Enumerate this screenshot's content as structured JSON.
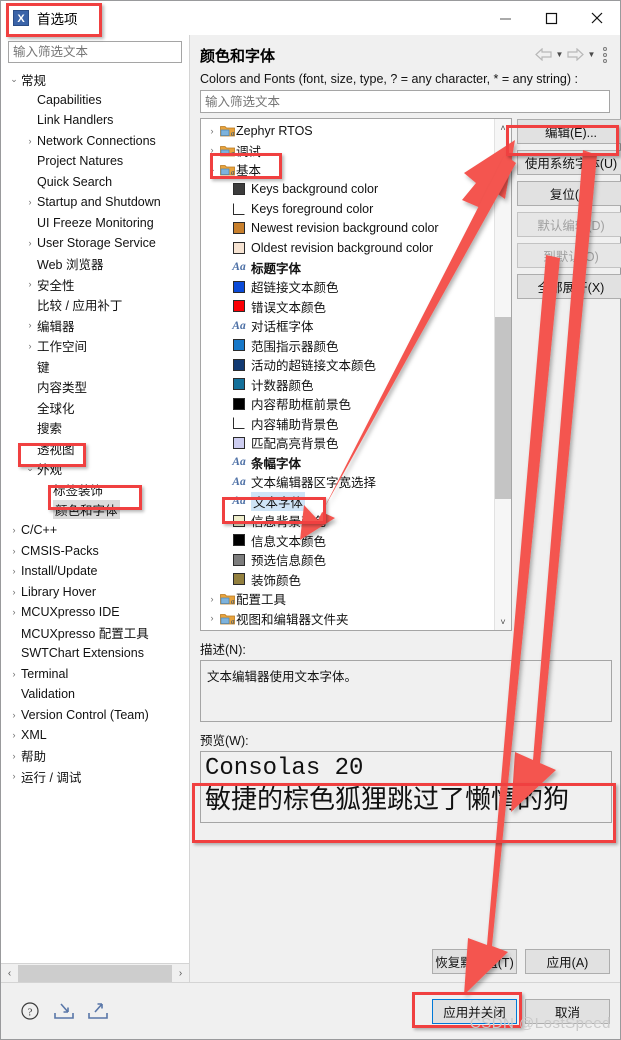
{
  "window": {
    "title": "首选项",
    "app_icon": "x-icon",
    "minimize_label": "—",
    "maximize_label": "□",
    "close_label": "✕"
  },
  "left": {
    "filter_placeholder": "输入筛选文本",
    "tree": [
      {
        "label": "常规",
        "level": 0,
        "arrow": "down"
      },
      {
        "label": "Capabilities",
        "level": 1,
        "arrow": "none"
      },
      {
        "label": "Link Handlers",
        "level": 1,
        "arrow": "none"
      },
      {
        "label": "Network Connections",
        "level": 1,
        "arrow": "right"
      },
      {
        "label": "Project Natures",
        "level": 1,
        "arrow": "none"
      },
      {
        "label": "Quick Search",
        "level": 1,
        "arrow": "none"
      },
      {
        "label": "Startup and Shutdown",
        "level": 1,
        "arrow": "right"
      },
      {
        "label": "UI Freeze Monitoring",
        "level": 1,
        "arrow": "none"
      },
      {
        "label": "User Storage Service",
        "level": 1,
        "arrow": "right"
      },
      {
        "label": "Web 浏览器",
        "level": 1,
        "arrow": "none"
      },
      {
        "label": "安全性",
        "level": 1,
        "arrow": "right"
      },
      {
        "label": "比较 / 应用补丁",
        "level": 1,
        "arrow": "none"
      },
      {
        "label": "编辑器",
        "level": 1,
        "arrow": "right"
      },
      {
        "label": "工作空间",
        "level": 1,
        "arrow": "right"
      },
      {
        "label": "键",
        "level": 1,
        "arrow": "none"
      },
      {
        "label": "内容类型",
        "level": 1,
        "arrow": "none"
      },
      {
        "label": "全球化",
        "level": 1,
        "arrow": "none"
      },
      {
        "label": "搜索",
        "level": 1,
        "arrow": "none"
      },
      {
        "label": "透视图",
        "level": 1,
        "arrow": "none"
      },
      {
        "label": "外观",
        "level": 1,
        "arrow": "down"
      },
      {
        "label": "标签装饰",
        "level": 2,
        "arrow": "none"
      },
      {
        "label": "颜色和字体",
        "level": 2,
        "arrow": "none",
        "selected": true
      },
      {
        "label": "C/C++",
        "level": 0,
        "arrow": "right"
      },
      {
        "label": "CMSIS-Packs",
        "level": 0,
        "arrow": "right"
      },
      {
        "label": "Install/Update",
        "level": 0,
        "arrow": "right"
      },
      {
        "label": "Library Hover",
        "level": 0,
        "arrow": "right"
      },
      {
        "label": "MCUXpresso IDE",
        "level": 0,
        "arrow": "right"
      },
      {
        "label": "MCUXpresso 配置工具",
        "level": 0,
        "arrow": "none"
      },
      {
        "label": "SWTChart Extensions",
        "level": 0,
        "arrow": "none"
      },
      {
        "label": "Terminal",
        "level": 0,
        "arrow": "right"
      },
      {
        "label": "Validation",
        "level": 0,
        "arrow": "none"
      },
      {
        "label": "Version Control (Team)",
        "level": 0,
        "arrow": "right"
      },
      {
        "label": "XML",
        "level": 0,
        "arrow": "right"
      },
      {
        "label": "帮助",
        "level": 0,
        "arrow": "right"
      },
      {
        "label": "运行 / 调试",
        "level": 0,
        "arrow": "right"
      }
    ]
  },
  "right": {
    "page_title": "颜色和字体",
    "subtitle": "Colors and Fonts (font, size, type, ? = any character, * = any string) :",
    "filter_placeholder": "输入筛选文本",
    "nav_back_icon": "arrow-left-icon",
    "nav_forward_icon": "arrow-right-icon",
    "menu_icon": "kebab-menu-icon",
    "tree": [
      {
        "label": "Zephyr RTOS",
        "level": 0,
        "arrow": "right",
        "icon": "folder-a-icon"
      },
      {
        "label": "调试",
        "level": 0,
        "arrow": "right",
        "icon": "folder-a-icon"
      },
      {
        "label": "基本",
        "level": 0,
        "arrow": "down",
        "icon": "folder-a-icon"
      },
      {
        "label": "Keys background color",
        "level": 1,
        "icon": "swatch",
        "color": "#3c3c3c"
      },
      {
        "label": "Keys foreground color",
        "level": 1,
        "icon": "swatch",
        "color": "#ffffff"
      },
      {
        "label": "Newest revision background color",
        "level": 1,
        "icon": "swatch",
        "color": "#c8802d"
      },
      {
        "label": "Oldest revision background color",
        "level": 1,
        "icon": "swatch",
        "color": "#f6e3d2"
      },
      {
        "label": "标题字体",
        "level": 1,
        "icon": "aa",
        "bold": true
      },
      {
        "label": "超链接文本颜色",
        "level": 1,
        "icon": "swatch",
        "color": "#0b4bd8"
      },
      {
        "label": "错误文本颜色",
        "level": 1,
        "icon": "swatch",
        "color": "#fb0005"
      },
      {
        "label": "对话框字体",
        "level": 1,
        "icon": "aa"
      },
      {
        "label": "范围指示器颜色",
        "level": 1,
        "icon": "swatch",
        "color": "#1878c8"
      },
      {
        "label": "活动的超链接文本颜色",
        "level": 1,
        "icon": "swatch",
        "color": "#123a72"
      },
      {
        "label": "计数器颜色",
        "level": 1,
        "icon": "swatch",
        "color": "#14709a"
      },
      {
        "label": "内容帮助框前景色",
        "level": 1,
        "icon": "swatch",
        "color": "#000000"
      },
      {
        "label": "内容辅助背景色",
        "level": 1,
        "icon": "swatch",
        "color": "#ffffff"
      },
      {
        "label": "匹配高亮背景色",
        "level": 1,
        "icon": "swatch",
        "color": "#cdcdf0"
      },
      {
        "label": "条幅字体",
        "level": 1,
        "icon": "aa",
        "bold": true
      },
      {
        "label": "文本编辑器区字宽选择",
        "level": 1,
        "icon": "aa"
      },
      {
        "label": "文本字体",
        "level": 1,
        "icon": "aa",
        "selected": true
      },
      {
        "label": "信息背景颜色",
        "level": 1,
        "icon": "swatch",
        "color": "#eeedcb"
      },
      {
        "label": "信息文本颜色",
        "level": 1,
        "icon": "swatch",
        "color": "#000000"
      },
      {
        "label": "预选信息颜色",
        "level": 1,
        "icon": "swatch",
        "color": "#7d7d7d"
      },
      {
        "label": "装饰颜色",
        "level": 1,
        "icon": "swatch",
        "color": "#93803f"
      },
      {
        "label": "配置工具",
        "level": 0,
        "arrow": "right",
        "icon": "folder-a-icon"
      },
      {
        "label": "视图和编辑器文件夹",
        "level": 0,
        "arrow": "right",
        "icon": "folder-a-icon"
      }
    ],
    "side_buttons": [
      {
        "label": "编辑(E)...",
        "enabled": true,
        "name": "edit-button"
      },
      {
        "label": "使用系统字体(U)",
        "enabled": true,
        "name": "use-system-font-button"
      },
      {
        "label": "复位(R)",
        "enabled": true,
        "name": "reset-button"
      },
      {
        "label": "默认编辑(D)",
        "enabled": false,
        "name": "edit-default-button"
      },
      {
        "label": "到默认(O)",
        "enabled": false,
        "name": "go-to-default-button"
      },
      {
        "label": "全部展开(X)",
        "enabled": true,
        "name": "expand-all-button"
      }
    ],
    "description_label": "描述(N):",
    "description_text": "文本编辑器使用文本字体。",
    "preview_label": "预览(W):",
    "preview_line1": "Consolas 20",
    "preview_line2": "敏捷的棕色狐狸跳过了懒惰的狗",
    "restore_defaults_label": "恢复默认值(T)",
    "apply_label": "应用(A)"
  },
  "footer": {
    "help_icon": "help-icon",
    "import_icon": "import-icon",
    "export_icon": "export-icon",
    "apply_and_close_label": "应用并关闭",
    "cancel_label": "取消"
  },
  "left_scroll": {
    "left_arrow": "‹",
    "right_arrow": "›"
  },
  "watermark": "CSDN @LostSpeed",
  "colors": {
    "accent": "#0078d7",
    "annotation": "#f04040",
    "selection": "#cfe4f7",
    "dialog_bg": "#f0f0f0"
  }
}
